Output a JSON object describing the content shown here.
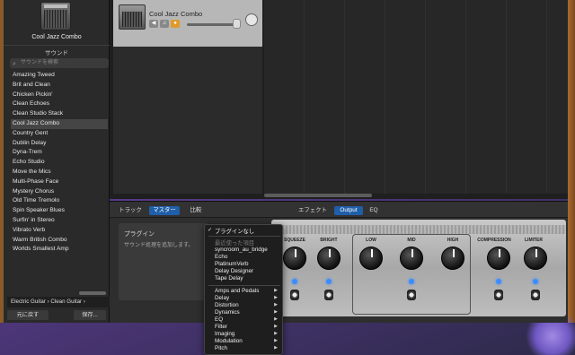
{
  "library": {
    "preset_title": "Cool Jazz Combo",
    "section_title": "サウンド",
    "search_placeholder": "サウンドを検索",
    "items": [
      "Amazing Tweed",
      "Brit and Clean",
      "Chicken Pickin'",
      "Clean Echoes",
      "Clean Studio Stack",
      "Cool Jazz Combo",
      "Country Gent",
      "Dublin Delay",
      "Dyna-Trem",
      "Echo Studio",
      "Move the Mics",
      "Multi-Phase Face",
      "Mystery Chorus",
      "Old Time Tremolo",
      "Spin Speaker Blues",
      "Surfin' in Stereo",
      "Vibrato Verb",
      "Warm British Combo",
      "Worlds Smallest Amp"
    ],
    "selected_index": 5,
    "breadcrumb": [
      "Electric Guitar",
      "Clean Guitar"
    ],
    "revert_button": "元に戻す",
    "save_button": "保存..."
  },
  "track": {
    "name": "Cool Jazz Combo",
    "mute_icon": "speaker-icon",
    "headphones_icon": "headphones-icon",
    "record_icon": "record-arm-icon"
  },
  "smart_controls": {
    "left_tabs": [
      "トラック",
      "マスター",
      "比較"
    ],
    "active_left_tab": "マスター",
    "right_tabs": [
      "エフェクト",
      "Output",
      "EQ"
    ],
    "active_right_tab": "Output",
    "plugin_title": "プラグイン",
    "plugin_desc": "サウンド処理を追加します。",
    "knobs": [
      "SQUEEZE",
      "BRIGHT",
      "LOW",
      "MID",
      "HIGH",
      "COMPRESSION",
      "LIMITER"
    ]
  },
  "menu": {
    "checked_item": "プラグインなし",
    "recent_header": "最近使った項目",
    "recent": [
      "syncroom_au_bridge",
      "Echo",
      "PlatinumVerb",
      "Delay Designer",
      "Tape Delay"
    ],
    "categories": [
      "Amps and Pedals",
      "Delay",
      "Distortion",
      "Dynamics",
      "EQ",
      "Filter",
      "Imaging",
      "Modulation",
      "Pitch"
    ]
  },
  "colors": {
    "accent": "#1f5ea8",
    "led": "#3d8cff"
  }
}
